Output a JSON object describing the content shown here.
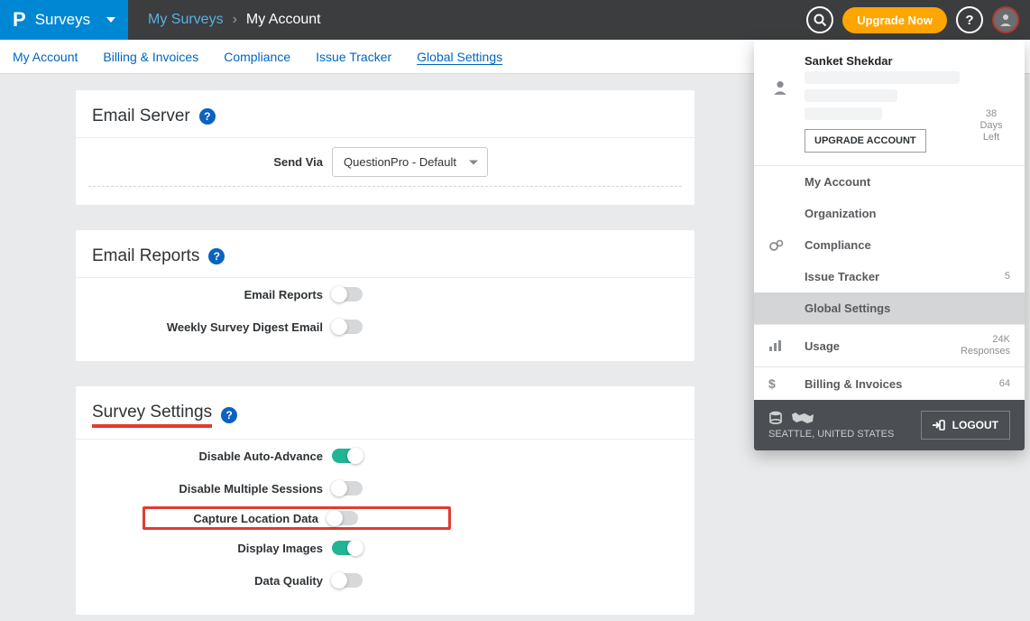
{
  "header": {
    "brand_logo": "P",
    "brand_title": "Surveys",
    "crumb1": "My Surveys",
    "crumb2": "My Account",
    "upgrade": "Upgrade Now"
  },
  "tabs": {
    "t0": "My Account",
    "t1": "Billing & Invoices",
    "t2": "Compliance",
    "t3": "Issue Tracker",
    "t4": "Global Settings"
  },
  "panel_email_server": {
    "title": "Email Server",
    "send_via_label": "Send Via",
    "send_via_value": "QuestionPro - Default"
  },
  "panel_email_reports": {
    "title": "Email Reports",
    "r0": "Email Reports",
    "r1": "Weekly Survey Digest Email"
  },
  "panel_survey_settings": {
    "title": "Survey Settings",
    "r0": "Disable Auto-Advance",
    "r1": "Disable Multiple Sessions",
    "r2": "Capture Location Data",
    "r3": "Display Images",
    "r4": "Data Quality"
  },
  "account_menu": {
    "name": "Sanket Shekdar",
    "days_num": "38",
    "days_label": "Days Left",
    "upgrade_account": "UPGRADE ACCOUNT",
    "items": [
      {
        "label": "My Account"
      },
      {
        "label": "Organization"
      },
      {
        "label": "Compliance"
      },
      {
        "label": "Issue Tracker",
        "right1": "5"
      },
      {
        "label": "Global Settings"
      },
      {
        "label": "Usage",
        "right1": "24K",
        "right2": "Responses"
      },
      {
        "label": "Billing & Invoices",
        "right1": "64"
      }
    ],
    "location": "SEATTLE, UNITED STATES",
    "logout": "LOGOUT"
  }
}
